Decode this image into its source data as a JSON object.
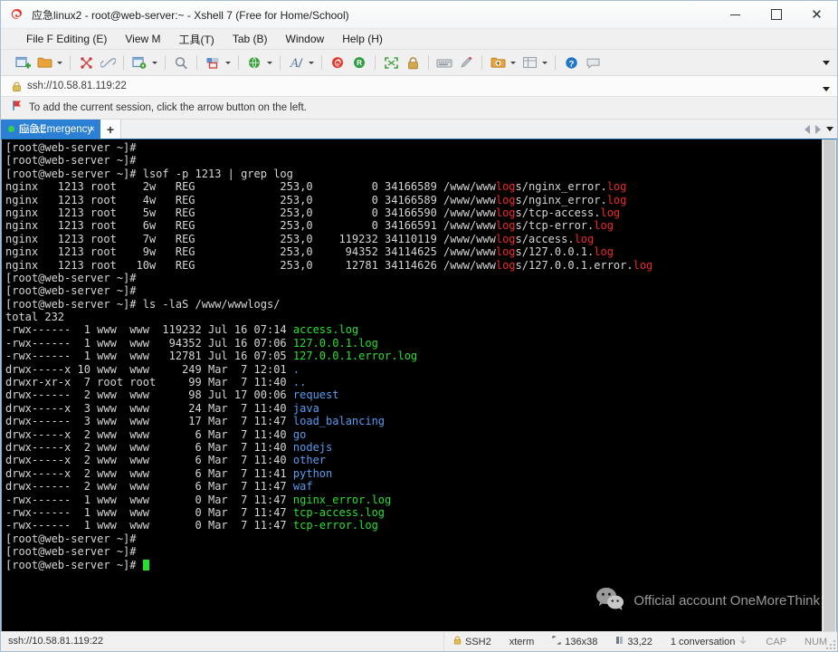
{
  "window": {
    "title": "应急linux2 - root@web-server:~ - Xshell 7 (Free for Home/School)",
    "app_icon": "xshell-icon",
    "minimize": "–",
    "maximize": "□",
    "close": "✕"
  },
  "menubar": {
    "items": [
      {
        "label": "File F Editing (E)",
        "name": "menu-file-editing"
      },
      {
        "label": "View M",
        "name": "menu-view"
      },
      {
        "label": "工具(T)",
        "name": "menu-tools"
      },
      {
        "label": "Tab (B)",
        "name": "menu-tab"
      },
      {
        "label": "Window",
        "name": "menu-window"
      },
      {
        "label": "Help (H)",
        "name": "menu-help"
      }
    ]
  },
  "toolbar": {
    "items": [
      {
        "icon": "new-session-icon",
        "caret": false
      },
      {
        "icon": "open-folder-icon",
        "caret": true
      },
      {
        "sep": true
      },
      {
        "icon": "disconnect-icon",
        "caret": false
      },
      {
        "icon": "link-icon",
        "caret": false
      },
      {
        "sep": true
      },
      {
        "icon": "session-properties-icon",
        "caret": true
      },
      {
        "sep": true
      },
      {
        "icon": "find-icon",
        "caret": false
      },
      {
        "sep": true
      },
      {
        "icon": "layout-icon",
        "caret": true
      },
      {
        "sep": true
      },
      {
        "icon": "globe-icon",
        "caret": true
      },
      {
        "sep": true
      },
      {
        "icon": "font-icon",
        "caret": true
      },
      {
        "sep": true
      },
      {
        "icon": "xshell-red-icon",
        "caret": false
      },
      {
        "icon": "xftp-green-icon",
        "caret": false
      },
      {
        "sep": true
      },
      {
        "icon": "fullscreen-icon",
        "caret": false
      },
      {
        "icon": "lock-icon",
        "caret": false
      },
      {
        "sep": true
      },
      {
        "icon": "keyboard-icon",
        "caret": false
      },
      {
        "icon": "compose-pen-icon",
        "caret": false
      },
      {
        "sep": true
      },
      {
        "icon": "add-to-folder-icon",
        "caret": true
      },
      {
        "icon": "split-view-icon",
        "caret": true
      },
      {
        "sep": true
      },
      {
        "icon": "help-icon",
        "caret": false
      },
      {
        "icon": "chat-icon",
        "caret": false
      }
    ],
    "overflow": "toolbar-overflow-chevron"
  },
  "addressbar": {
    "icon": "lock-icon",
    "value": "ssh://10.58.81.119:22",
    "dropdown": "address-dropdown-chevron"
  },
  "hintbar": {
    "icon": "red-flag-icon",
    "text": "To add the current session, click the arrow button on the left."
  },
  "tabs": {
    "items": [
      {
        "label_primary": "应急Emergency",
        "label_secondary": "linux2",
        "status": "connected",
        "close": "×"
      }
    ],
    "new_tab": "+",
    "nav_prev": "◀",
    "nav_next": "▶",
    "nav_menu": "▾"
  },
  "terminal": {
    "prompt": "[root@web-server ~]#",
    "cols": 136,
    "rows": 38,
    "lines": [
      {
        "segs": [
          {
            "t": "[root@web-server ~]# ",
            "c": "white"
          }
        ]
      },
      {
        "segs": [
          {
            "t": "[root@web-server ~]# ",
            "c": "white"
          }
        ]
      },
      {
        "segs": [
          {
            "t": "[root@web-server ~]# lsof -p 1213 | grep log",
            "c": "white"
          }
        ]
      },
      {
        "segs": [
          {
            "t": "nginx   1213 root    2w   REG             253,0         0 34166589 /www/www",
            "c": "white"
          },
          {
            "t": "log",
            "c": "red"
          },
          {
            "t": "s/nginx_error.",
            "c": "white"
          },
          {
            "t": "log",
            "c": "red"
          }
        ]
      },
      {
        "segs": [
          {
            "t": "nginx   1213 root    4w   REG             253,0         0 34166589 /www/www",
            "c": "white"
          },
          {
            "t": "log",
            "c": "red"
          },
          {
            "t": "s/nginx_error.",
            "c": "white"
          },
          {
            "t": "log",
            "c": "red"
          }
        ]
      },
      {
        "segs": [
          {
            "t": "nginx   1213 root    5w   REG             253,0         0 34166590 /www/www",
            "c": "white"
          },
          {
            "t": "log",
            "c": "red"
          },
          {
            "t": "s/tcp-access.",
            "c": "white"
          },
          {
            "t": "log",
            "c": "red"
          }
        ]
      },
      {
        "segs": [
          {
            "t": "nginx   1213 root    6w   REG             253,0         0 34166591 /www/www",
            "c": "white"
          },
          {
            "t": "log",
            "c": "red"
          },
          {
            "t": "s/tcp-error.",
            "c": "white"
          },
          {
            "t": "log",
            "c": "red"
          }
        ]
      },
      {
        "segs": [
          {
            "t": "nginx   1213 root    7w   REG             253,0    119232 34110119 /www/www",
            "c": "white"
          },
          {
            "t": "log",
            "c": "red"
          },
          {
            "t": "s/access.",
            "c": "white"
          },
          {
            "t": "log",
            "c": "red"
          }
        ]
      },
      {
        "segs": [
          {
            "t": "nginx   1213 root    9w   REG             253,0     94352 34114625 /www/www",
            "c": "white"
          },
          {
            "t": "log",
            "c": "red"
          },
          {
            "t": "s/127.0.0.1.",
            "c": "white"
          },
          {
            "t": "log",
            "c": "red"
          }
        ]
      },
      {
        "segs": [
          {
            "t": "nginx   1213 root   10w   REG             253,0     12781 34114626 /www/www",
            "c": "white"
          },
          {
            "t": "log",
            "c": "red"
          },
          {
            "t": "s/127.0.0.1.error.",
            "c": "white"
          },
          {
            "t": "log",
            "c": "red"
          }
        ]
      },
      {
        "segs": [
          {
            "t": "[root@web-server ~]# ",
            "c": "white"
          }
        ]
      },
      {
        "segs": [
          {
            "t": "[root@web-server ~]# ",
            "c": "white"
          }
        ]
      },
      {
        "segs": [
          {
            "t": "[root@web-server ~]# ls -laS /www/wwwlogs/",
            "c": "white"
          }
        ]
      },
      {
        "segs": [
          {
            "t": "total 232",
            "c": "white"
          }
        ]
      },
      {
        "segs": [
          {
            "t": "-rwx------  1 www  www  119232 Jul 16 07:14 ",
            "c": "white"
          },
          {
            "t": "access.log",
            "c": "green"
          }
        ]
      },
      {
        "segs": [
          {
            "t": "-rwx------  1 www  www   94352 Jul 16 07:06 ",
            "c": "white"
          },
          {
            "t": "127.0.0.1.log",
            "c": "green"
          }
        ]
      },
      {
        "segs": [
          {
            "t": "-rwx------  1 www  www   12781 Jul 16 07:05 ",
            "c": "white"
          },
          {
            "t": "127.0.0.1.error.log",
            "c": "green"
          }
        ]
      },
      {
        "segs": [
          {
            "t": "drwx-----x 10 www  www     249 Mar  7 12:01 ",
            "c": "white"
          },
          {
            "t": ".",
            "c": "blue"
          }
        ]
      },
      {
        "segs": [
          {
            "t": "drwxr-xr-x  7 root root     99 Mar  7 11:40 ",
            "c": "white"
          },
          {
            "t": "..",
            "c": "blue"
          }
        ]
      },
      {
        "segs": [
          {
            "t": "drwx------  2 www  www      98 Jul 17 00:06 ",
            "c": "white"
          },
          {
            "t": "request",
            "c": "blue"
          }
        ]
      },
      {
        "segs": [
          {
            "t": "drwx-----x  3 www  www      24 Mar  7 11:40 ",
            "c": "white"
          },
          {
            "t": "java",
            "c": "blue"
          }
        ]
      },
      {
        "segs": [
          {
            "t": "drwx------  3 www  www      17 Mar  7 11:47 ",
            "c": "white"
          },
          {
            "t": "load_balancing",
            "c": "blue"
          }
        ]
      },
      {
        "segs": [
          {
            "t": "drwx-----x  2 www  www       6 Mar  7 11:40 ",
            "c": "white"
          },
          {
            "t": "go",
            "c": "blue"
          }
        ]
      },
      {
        "segs": [
          {
            "t": "drwx-----x  2 www  www       6 Mar  7 11:40 ",
            "c": "white"
          },
          {
            "t": "nodejs",
            "c": "blue"
          }
        ]
      },
      {
        "segs": [
          {
            "t": "drwx-----x  2 www  www       6 Mar  7 11:40 ",
            "c": "white"
          },
          {
            "t": "other",
            "c": "blue"
          }
        ]
      },
      {
        "segs": [
          {
            "t": "drwx-----x  2 www  www       6 Mar  7 11:41 ",
            "c": "white"
          },
          {
            "t": "python",
            "c": "blue"
          }
        ]
      },
      {
        "segs": [
          {
            "t": "drwx------  2 www  www       6 Mar  7 11:47 ",
            "c": "white"
          },
          {
            "t": "waf",
            "c": "blue"
          }
        ]
      },
      {
        "segs": [
          {
            "t": "-rwx------  1 www  www       0 Mar  7 11:47 ",
            "c": "white"
          },
          {
            "t": "nginx_error.log",
            "c": "green"
          }
        ]
      },
      {
        "segs": [
          {
            "t": "-rwx------  1 www  www       0 Mar  7 11:47 ",
            "c": "white"
          },
          {
            "t": "tcp-access.log",
            "c": "green"
          }
        ]
      },
      {
        "segs": [
          {
            "t": "-rwx------  1 www  www       0 Mar  7 11:47 ",
            "c": "white"
          },
          {
            "t": "tcp-error.log",
            "c": "green"
          }
        ]
      },
      {
        "segs": [
          {
            "t": "[root@web-server ~]# ",
            "c": "white"
          }
        ]
      },
      {
        "segs": [
          {
            "t": "[root@web-server ~]# ",
            "c": "white"
          }
        ]
      },
      {
        "segs": [
          {
            "t": "[root@web-server ~]# ",
            "c": "white"
          },
          {
            "t": "CURSOR",
            "c": "cursor"
          }
        ]
      }
    ],
    "watermark": {
      "icon": "wechat-icon",
      "text": "Official account OneMoreThink"
    }
  },
  "statusbar": {
    "session": "ssh://10.58.81.119:22",
    "protocol": "SSH2",
    "protocol_icon": "lock-icon",
    "terminal_type": "xterm",
    "size_icon": "terminal-size-icon",
    "size": "136x38",
    "cursor_icon": "cursor-pos-icon",
    "cursor": "33,22",
    "conversations": "1 conversation",
    "conversations_icon": "conversation-arrow-icon",
    "cap": "CAP",
    "num": "NUM"
  },
  "colors": {
    "accent": "#2b7fd4",
    "terminal_bg": "#000000",
    "green": "#27e02b",
    "red": "#ef2929",
    "blue": "#5a9bf0"
  }
}
